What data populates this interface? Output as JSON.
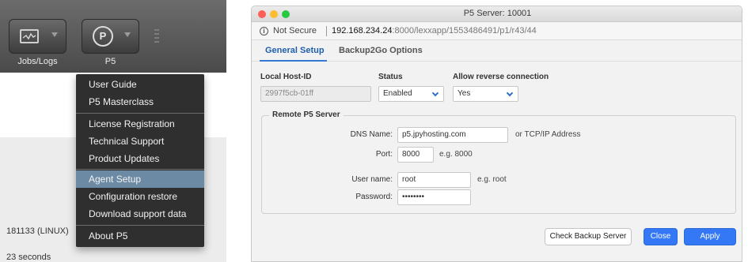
{
  "left_app": {
    "toolbar": {
      "jobs_label": "Jobs/Logs",
      "p5_label": "P5",
      "p5_icon_text": "P"
    },
    "status_lines": [
      "181133 (LINUX)",
      "23 seconds"
    ]
  },
  "p5_menu": {
    "items": [
      "User Guide",
      "P5 Masterclass",
      "License Registration",
      "Technical Support",
      "Product Updates",
      "Agent Setup",
      "Configuration restore",
      "Download support data",
      "About P5"
    ],
    "highlighted": "Agent Setup"
  },
  "window": {
    "title": "P5 Server: 10001",
    "address": {
      "security": "Not Secure",
      "info_icon": "i",
      "host": "192.168.234.24",
      "path": ":8000/lexxapp/1553486491/p1/r43/44"
    },
    "tabs": [
      "General Setup",
      "Backup2Go Options"
    ],
    "active_tab": "General Setup",
    "local_host_id": {
      "label": "Local Host-ID",
      "value": "2997f5cb-01ff"
    },
    "status": {
      "label": "Status",
      "value": "Enabled"
    },
    "reverse": {
      "label": "Allow reverse connection",
      "value": "Yes"
    },
    "remote": {
      "legend": "Remote P5 Server",
      "dns_label": "DNS Name:",
      "dns_value": "p5.jpyhosting.com",
      "dns_hint": "or TCP/IP Address",
      "port_label": "Port:",
      "port_value": "8000",
      "port_hint": "e.g. 8000",
      "user_label": "User name:",
      "user_value": "root",
      "user_hint": "e.g. root",
      "password_label": "Password:",
      "password_value": "••••••••"
    },
    "buttons": {
      "check": "Check Backup Server",
      "close": "Close",
      "apply": "Apply"
    }
  },
  "colors": {
    "menu_highlight": "#6d8aa5",
    "primary_button": "#3478f6",
    "active_tab": "#1e5fad"
  }
}
